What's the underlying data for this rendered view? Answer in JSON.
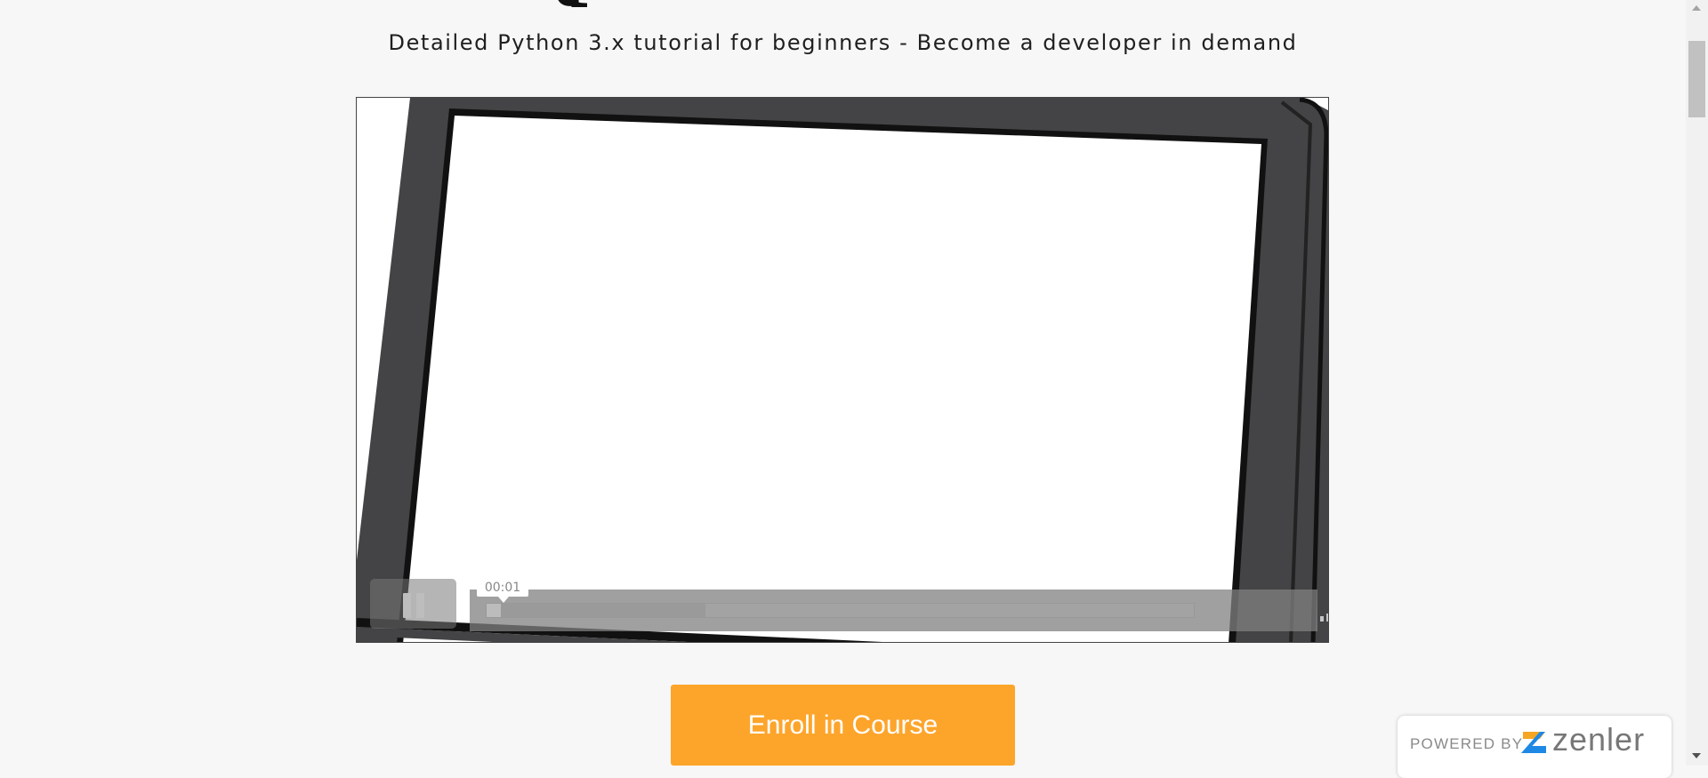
{
  "header": {
    "subtitle": "Detailed Python 3.x tutorial for beginners - Become a developer in demand"
  },
  "video_player": {
    "current_time": "00:01",
    "playback_state": "playing",
    "progress_played_fraction": 0.02,
    "progress_buffered_fraction": 0.31,
    "icons": [
      "pause-icon",
      "volume-icon",
      "gear-icon",
      "fullscreen-icon"
    ]
  },
  "enroll": {
    "label": "Enroll in Course",
    "color": "#fda52b"
  },
  "badge": {
    "powered_by": "POWERED BY",
    "brand": "zenler",
    "logo_colors": [
      "#f5a623",
      "#1e88e5"
    ]
  }
}
